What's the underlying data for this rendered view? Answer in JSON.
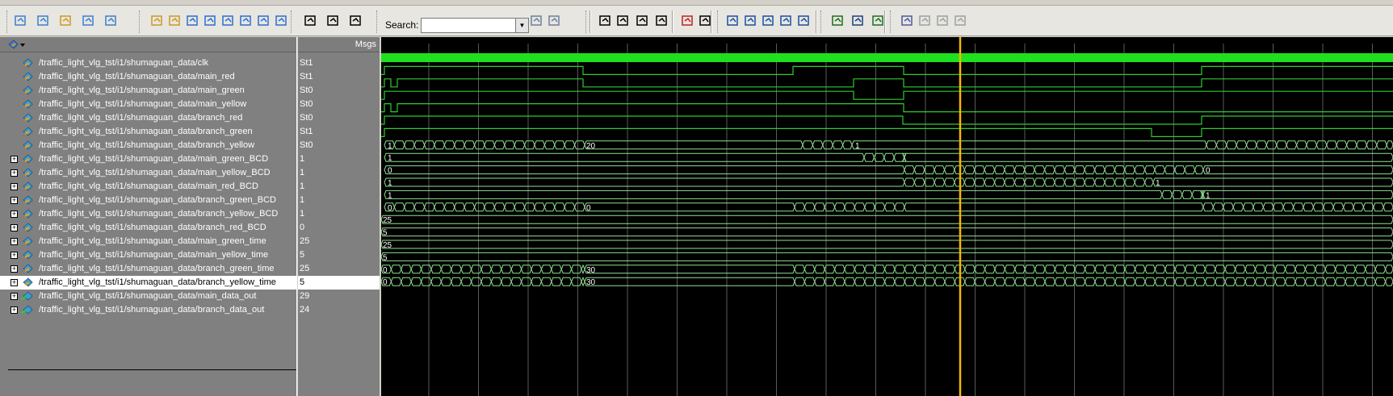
{
  "toolbar": {
    "search_label": "Search:",
    "search_value": "",
    "icons": [
      "add-wave-icon",
      "add-list-icon",
      "add-memory-icon",
      "dataflow-icon",
      "restart-icon",
      "insert-cursor-icon",
      "delete-cursor-icon",
      "prev-edge-icon",
      "next-edge-icon",
      "prev-falling-icon",
      "next-falling-icon",
      "prev-rising-icon",
      "next-rising-icon",
      "step-back-icon",
      "step-over-icon",
      "step-into-icon",
      "binoculars-icon",
      "find-next-icon",
      "select-mode-icon",
      "zoom-mode-icon",
      "pan-mode-icon",
      "edit-mode-icon",
      "stop-icon",
      "run-icon",
      "zoom-in-icon",
      "zoom-out-icon",
      "zoom-full-icon",
      "zoom-cursor-icon",
      "zoom-range-icon",
      "cursor-icon",
      "cursor-lock-icon",
      "add-cursor-icon",
      "wave-color-icon",
      "rising-edge-icon",
      "falling-edge-icon",
      "any-edge-icon"
    ]
  },
  "headers": {
    "msgs": "Msgs"
  },
  "signals": [
    {
      "name": "/traffic_light_vlg_tst/i1/shumaguan_data/clk",
      "value": "St1",
      "bus": false,
      "type": "in"
    },
    {
      "name": "/traffic_light_vlg_tst/i1/shumaguan_data/main_red",
      "value": "St1",
      "bus": false,
      "type": "in"
    },
    {
      "name": "/traffic_light_vlg_tst/i1/shumaguan_data/main_green",
      "value": "St0",
      "bus": false,
      "type": "in"
    },
    {
      "name": "/traffic_light_vlg_tst/i1/shumaguan_data/main_yellow",
      "value": "St0",
      "bus": false,
      "type": "in"
    },
    {
      "name": "/traffic_light_vlg_tst/i1/shumaguan_data/branch_red",
      "value": "St0",
      "bus": false,
      "type": "in"
    },
    {
      "name": "/traffic_light_vlg_tst/i1/shumaguan_data/branch_green",
      "value": "St1",
      "bus": false,
      "type": "in"
    },
    {
      "name": "/traffic_light_vlg_tst/i1/shumaguan_data/branch_yellow",
      "value": "St0",
      "bus": false,
      "type": "in"
    },
    {
      "name": "/traffic_light_vlg_tst/i1/shumaguan_data/main_green_BCD",
      "value": "1",
      "bus": true,
      "type": "in"
    },
    {
      "name": "/traffic_light_vlg_tst/i1/shumaguan_data/main_yellow_BCD",
      "value": "1",
      "bus": true,
      "type": "in"
    },
    {
      "name": "/traffic_light_vlg_tst/i1/shumaguan_data/main_red_BCD",
      "value": "1",
      "bus": true,
      "type": "in"
    },
    {
      "name": "/traffic_light_vlg_tst/i1/shumaguan_data/branch_green_BCD",
      "value": "1",
      "bus": true,
      "type": "in"
    },
    {
      "name": "/traffic_light_vlg_tst/i1/shumaguan_data/branch_yellow_BCD",
      "value": "1",
      "bus": true,
      "type": "in"
    },
    {
      "name": "/traffic_light_vlg_tst/i1/shumaguan_data/branch_red_BCD",
      "value": "0",
      "bus": true,
      "type": "in"
    },
    {
      "name": "/traffic_light_vlg_tst/i1/shumaguan_data/main_green_time",
      "value": "25",
      "bus": true,
      "type": "in"
    },
    {
      "name": "/traffic_light_vlg_tst/i1/shumaguan_data/main_yellow_time",
      "value": "5",
      "bus": true,
      "type": "in"
    },
    {
      "name": "/traffic_light_vlg_tst/i1/shumaguan_data/branch_green_time",
      "value": "25",
      "bus": true,
      "type": "in"
    },
    {
      "name": "/traffic_light_vlg_tst/i1/shumaguan_data/branch_yellow_time",
      "value": "5",
      "bus": true,
      "type": "in",
      "selected": true
    },
    {
      "name": "/traffic_light_vlg_tst/i1/shumaguan_data/main_data_out",
      "value": "29",
      "bus": true,
      "type": "out"
    },
    {
      "name": "/traffic_light_vlg_tst/i1/shumaguan_data/branch_data_out",
      "value": "24",
      "bus": true,
      "type": "out"
    }
  ],
  "wave_labels": {
    "main_green_BCD": [
      "1",
      "20",
      "1"
    ],
    "main_yellow_BCD": [
      "1"
    ],
    "main_red_BCD": [
      "0",
      "0"
    ],
    "branch_green_BCD": [
      "1",
      "1"
    ],
    "branch_yellow_BCD": [
      "1",
      "1"
    ],
    "branch_red_BCD": [
      "0",
      "0"
    ],
    "main_green_time": [
      "25"
    ],
    "main_yellow_time": [
      "5"
    ],
    "branch_green_time": [
      "25"
    ],
    "branch_yellow_time": [
      "5"
    ],
    "main_data_out": [
      "0",
      "30"
    ],
    "branch_data_out": [
      "0",
      "30"
    ]
  },
  "colors": {
    "wave": "#2fcb2f",
    "cursor": "#f5b800",
    "background": "#000000"
  }
}
